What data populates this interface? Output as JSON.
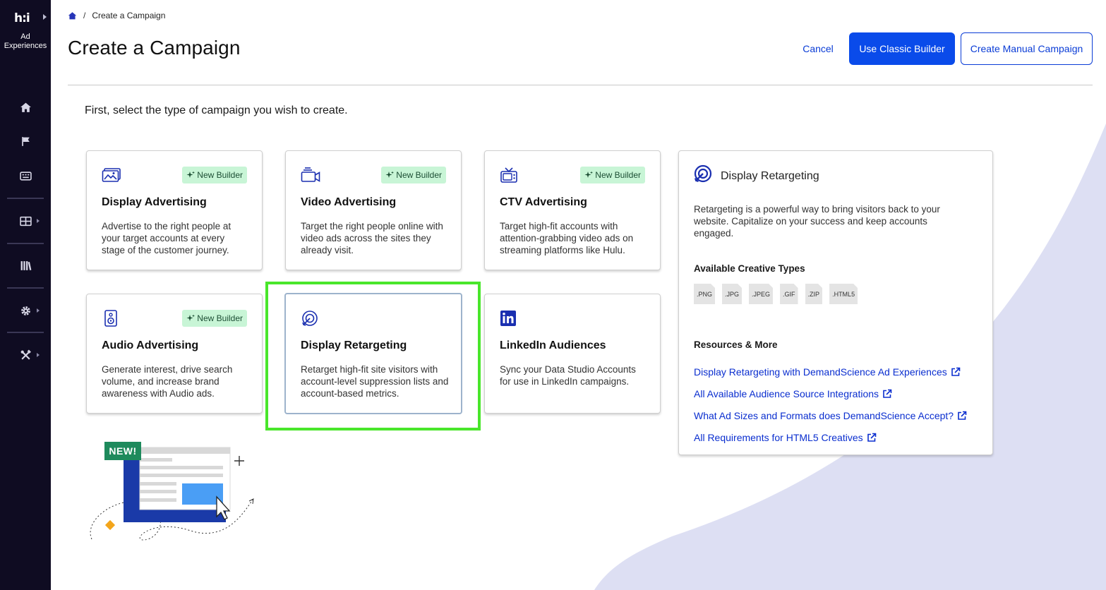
{
  "sidebar": {
    "logo_text": "h:i",
    "product_label": "Ad Experiences",
    "nav": [
      {
        "name": "home-icon"
      },
      {
        "name": "flag-icon"
      },
      {
        "name": "keyboard-icon"
      },
      {
        "name": "table-icon"
      },
      {
        "name": "library-icon"
      },
      {
        "name": "gear-icon"
      },
      {
        "name": "tools-icon"
      }
    ]
  },
  "breadcrumb": {
    "home_icon": "home-icon",
    "separator": "/",
    "current": "Create a Campaign"
  },
  "header": {
    "title": "Create a Campaign",
    "cancel_label": "Cancel",
    "classic_builder_label": "Use Classic Builder",
    "manual_campaign_label": "Create Manual Campaign"
  },
  "subtitle": "First, select the type of campaign you wish to create.",
  "cards": [
    {
      "icon": "image-icon",
      "badge": "New Builder",
      "title": "Display Advertising",
      "description": "Advertise to the right people at your target accounts at every stage of the customer journey."
    },
    {
      "icon": "video-icon",
      "badge": "New Builder",
      "title": "Video Advertising",
      "description": "Target the right people online with video ads across the sites they already visit."
    },
    {
      "icon": "tv-icon",
      "badge": "New Builder",
      "title": "CTV Advertising",
      "description": "Target high-fit accounts with attention-grabbing video ads on streaming platforms like Hulu."
    },
    {
      "icon": "speaker-icon",
      "badge": "New Builder",
      "title": "Audio Advertising",
      "description": "Generate interest, drive search volume, and increase brand awareness with Audio ads."
    },
    {
      "icon": "retargeting-icon",
      "title": "Display Retargeting",
      "description": "Retarget high-fit site visitors with account-level suppression lists and account-based metrics.",
      "selected": true
    },
    {
      "icon": "linkedin-icon",
      "title": "LinkedIn Audiences",
      "description": "Sync your Data Studio Accounts for use in LinkedIn campaigns."
    }
  ],
  "panel": {
    "icon": "retargeting-icon",
    "title": "Display Retargeting",
    "description": "Retargeting is a powerful way to bring visitors back to your website. Capitalize on your success and keep accounts engaged.",
    "creative_types_heading": "Available Creative Types",
    "creative_types": [
      ".PNG",
      ".JPG",
      ".JPEG",
      ".GIF",
      ".ZIP",
      ".HTML5"
    ],
    "resources_heading": "Resources & More",
    "resources": [
      "Display Retargeting with DemandScience Ad Experiences",
      "All Available Audience Source Integrations",
      "What Ad Sizes and Formats does DemandScience Accept?",
      "All Requirements for HTML5 Creatives"
    ]
  },
  "illustration": {
    "label": "NEW!"
  },
  "colors": {
    "sidebar_bg": "#0f0c22",
    "primary": "#0a4bea",
    "link": "#0a2ecf",
    "badge_bg": "#c8f5d6",
    "highlight": "#49e62b",
    "decor": "#dddff3"
  }
}
